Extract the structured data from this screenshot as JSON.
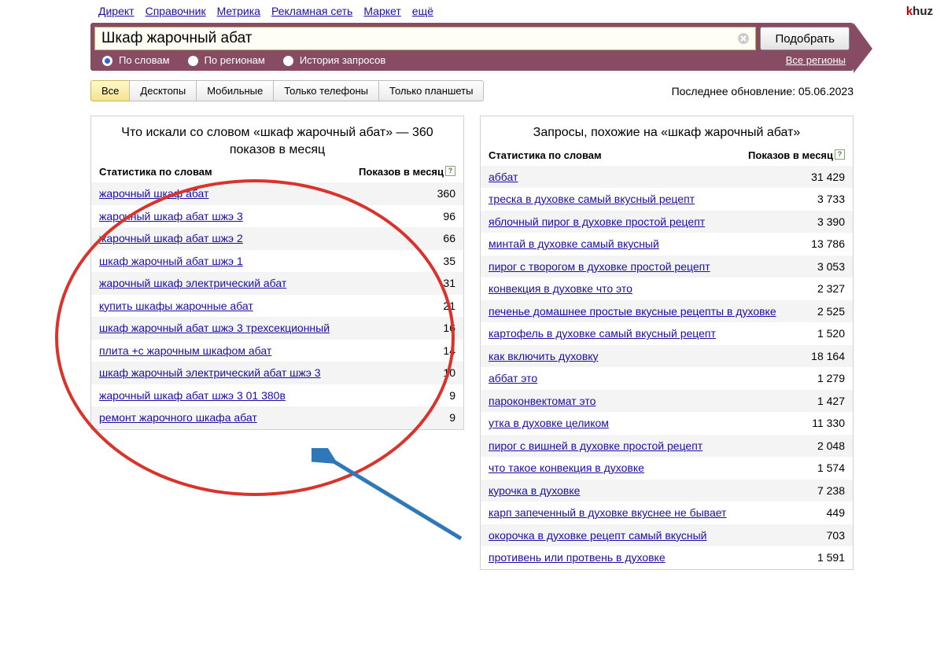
{
  "top_nav": [
    "Директ",
    "Справочник",
    "Метрика",
    "Рекламная сеть",
    "Маркет",
    "ещё"
  ],
  "brand": {
    "k": "k",
    "rest": "huz"
  },
  "search": {
    "value": "Шкаф жарочный абат",
    "submit_label": "Подобрать",
    "radios": [
      {
        "label": "По словам",
        "checked": true
      },
      {
        "label": "По регионам",
        "checked": false
      },
      {
        "label": "История запросов",
        "checked": false
      }
    ],
    "region_label": "Все регионы"
  },
  "tabs": [
    "Все",
    "Десктопы",
    "Мобильные",
    "Только телефоны",
    "Только планшеты"
  ],
  "active_tab_index": 0,
  "updated_label": "Последнее обновление: 05.06.2023",
  "left_panel": {
    "title": "Что искали со словом «шкаф жарочный абат» — 360 показов в месяц",
    "head_left": "Статистика по словам",
    "head_right": "Показов в месяц",
    "rows": [
      {
        "label": "жарочный шкаф абат",
        "count": "360"
      },
      {
        "label": "жарочный шкаф абат шжэ 3",
        "count": "96"
      },
      {
        "label": "жарочный шкаф абат шжэ 2",
        "count": "66"
      },
      {
        "label": "шкаф жарочный абат шжэ 1",
        "count": "35"
      },
      {
        "label": "жарочный шкаф электрический абат",
        "count": "31"
      },
      {
        "label": "купить шкафы жарочные абат",
        "count": "21"
      },
      {
        "label": "шкаф жарочный абат шжэ 3 трехсекционный",
        "count": "16"
      },
      {
        "label": "плита +с жарочным шкафом абат",
        "count": "14"
      },
      {
        "label": "шкаф жарочный электрический абат шжэ 3",
        "count": "10"
      },
      {
        "label": "жарочный шкаф абат шжэ 3 01 380в",
        "count": "9"
      },
      {
        "label": "ремонт жарочного шкафа абат",
        "count": "9"
      }
    ]
  },
  "right_panel": {
    "title": "Запросы, похожие на «шкаф жарочный абат»",
    "head_left": "Статистика по словам",
    "head_right": "Показов в месяц",
    "rows": [
      {
        "label": "аббат",
        "count": "31 429"
      },
      {
        "label": "треска в духовке самый вкусный рецепт",
        "count": "3 733"
      },
      {
        "label": "яблочный пирог в духовке простой рецепт",
        "count": "3 390"
      },
      {
        "label": "минтай в духовке самый вкусный",
        "count": "13 786"
      },
      {
        "label": "пирог с творогом в духовке простой рецепт",
        "count": "3 053"
      },
      {
        "label": "конвекция в духовке что это",
        "count": "2 327"
      },
      {
        "label": "печенье домашнее простые вкусные рецепты в духовке",
        "count": "2 525"
      },
      {
        "label": "картофель в духовке самый вкусный рецепт",
        "count": "1 520"
      },
      {
        "label": "как включить духовку",
        "count": "18 164"
      },
      {
        "label": "аббат это",
        "count": "1 279"
      },
      {
        "label": "пароконвектомат это",
        "count": "1 427"
      },
      {
        "label": "утка в духовке целиком",
        "count": "11 330"
      },
      {
        "label": "пирог с вишней в духовке простой рецепт",
        "count": "2 048"
      },
      {
        "label": "что такое конвекция в духовке",
        "count": "1 574"
      },
      {
        "label": "курочка в духовке",
        "count": "7 238"
      },
      {
        "label": "карп запеченный в духовке вкуснее не бывает",
        "count": "449"
      },
      {
        "label": "окорочка в духовке рецепт самый вкусный",
        "count": "703"
      },
      {
        "label": "противень или протвень в духовке",
        "count": "1 591"
      }
    ]
  }
}
